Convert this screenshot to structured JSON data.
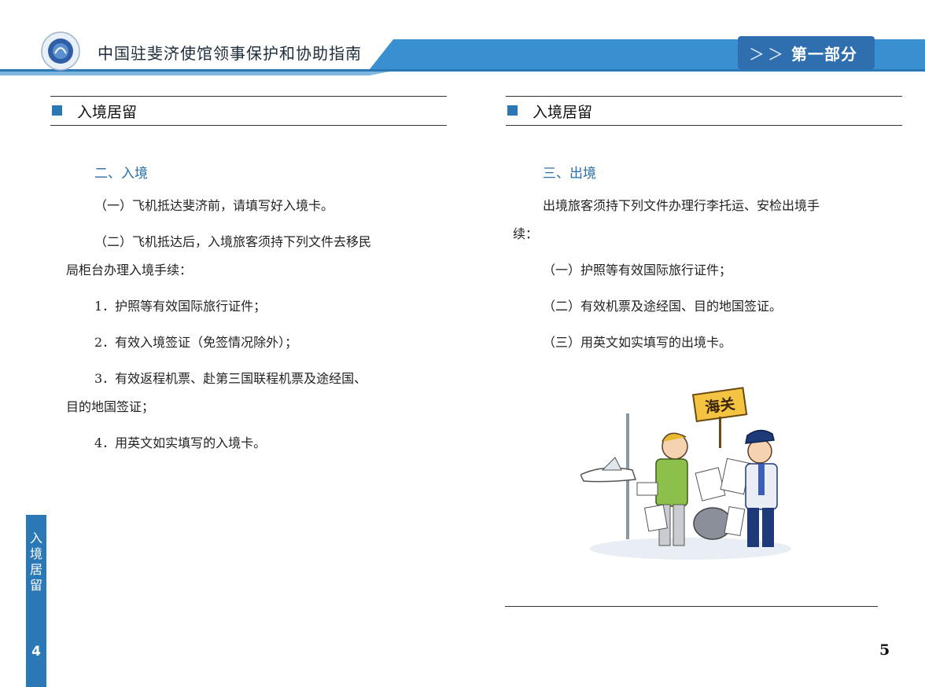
{
  "header": {
    "doc_title": "中国驻斐济使馆领事保护和协助指南",
    "part_chevrons": "＞＞",
    "part_label": "第一部分"
  },
  "left": {
    "section_title": "入境居留",
    "subtitle": "二、入境",
    "lines": [
      "（一）飞机抵达斐济前，请填写好入境卡。",
      "（二）飞机抵达后，入境旅客须持下列文件去移民",
      "局柜台办理入境手续：",
      "1．护照等有效国际旅行证件；",
      "2．有效入境签证（免签情况除外）；",
      "3．有效返程机票、赴第三国联程机票及途经国、",
      "目的地国签证；",
      "4．用英文如实填写的入境卡。"
    ],
    "side_tab_text": [
      "入",
      "境",
      "居",
      "留"
    ],
    "page_number": "4"
  },
  "right": {
    "section_title": "入境居留",
    "subtitle": "三、出境",
    "lines": [
      "出境旅客须持下列文件办理行李托运、安检出境手",
      "续：",
      "（一）护照等有效国际旅行证件；",
      "（二）有效机票及途经国、目的地国签证。",
      "（三）用英文如实填写的出境卡。"
    ],
    "illustration_sign": "海关",
    "page_number": "5"
  },
  "colors": {
    "accent": "#2a78b6",
    "header_band": "#3a8fd0"
  }
}
